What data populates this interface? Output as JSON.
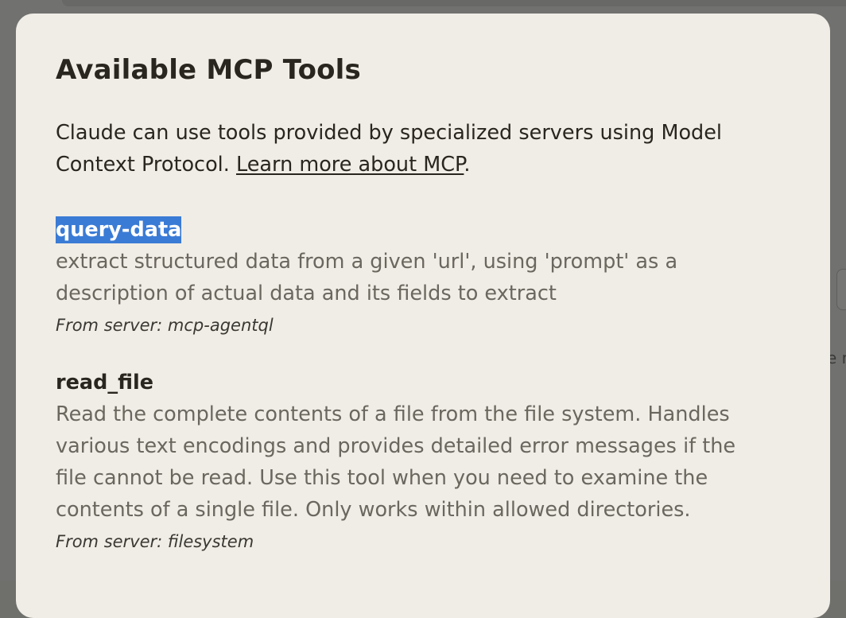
{
  "background": {
    "partial_text": "e r"
  },
  "modal": {
    "title": "Available MCP Tools",
    "intro_text": "Claude can use tools provided by specialized servers using Model Context Protocol. ",
    "learn_more_link": "Learn more about MCP",
    "intro_end": ".",
    "tools": [
      {
        "name": "query-data",
        "selected": true,
        "description": "extract structured data from a given 'url', using 'prompt' as a description of actual data and its fields to extract",
        "server": "From server: mcp-agentql"
      },
      {
        "name": "read_file",
        "selected": false,
        "description": "Read the complete contents of a file from the file system. Handles various text encodings and provides detailed error messages if the file cannot be read. Use this tool when you need to examine the contents of a single file. Only works within allowed directories.",
        "server": "From server: filesystem"
      }
    ]
  },
  "colors": {
    "modal_bg": "#f0ede6",
    "backdrop": "#717170",
    "selection": "#3a7bd5",
    "text_primary": "#28261f",
    "text_secondary": "#6a675f"
  }
}
